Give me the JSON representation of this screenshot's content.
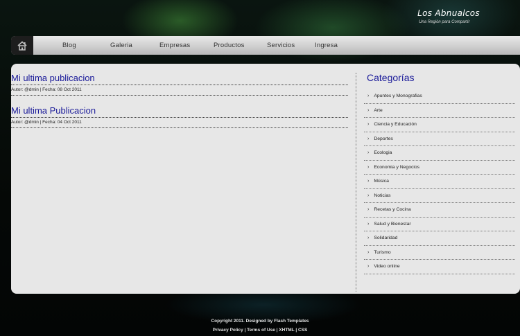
{
  "site": {
    "title": "Los Abnualcos",
    "tagline": "Una Región para Compartir"
  },
  "nav": {
    "items": [
      "Blog",
      "Galeria",
      "Empresas",
      "Productos",
      "Servicios",
      "Ingresa"
    ]
  },
  "posts": [
    {
      "title": "Mi ultima publicacion",
      "meta": "Autor: @dmin | Fecha: 08 Oct 2011"
    },
    {
      "title": "Mi ultima Publicacion",
      "meta": "Autor: @dmin | Fecha: 04 Oct 2011"
    }
  ],
  "sidebar": {
    "title": "Categorías",
    "categories": [
      "Apuntes y Monografias",
      "Arte",
      "Ciencia y Educación",
      "Deportes",
      "Ecologia",
      "Economia y Negocios",
      "Música",
      "Noticias",
      "Recetas y Cocina",
      "Salud y Bienestar",
      "Solidaridad",
      "Turismo",
      "Video online"
    ]
  },
  "footer": {
    "line1": "Copyright 2011. Designed by Flash Templates",
    "line2": "Privacy Policy | Terms of Use | XHTML | CSS"
  },
  "colors": {
    "heading": "#1a1a99",
    "panel": "#e7e7e7",
    "nav": "#cfcfcf"
  }
}
